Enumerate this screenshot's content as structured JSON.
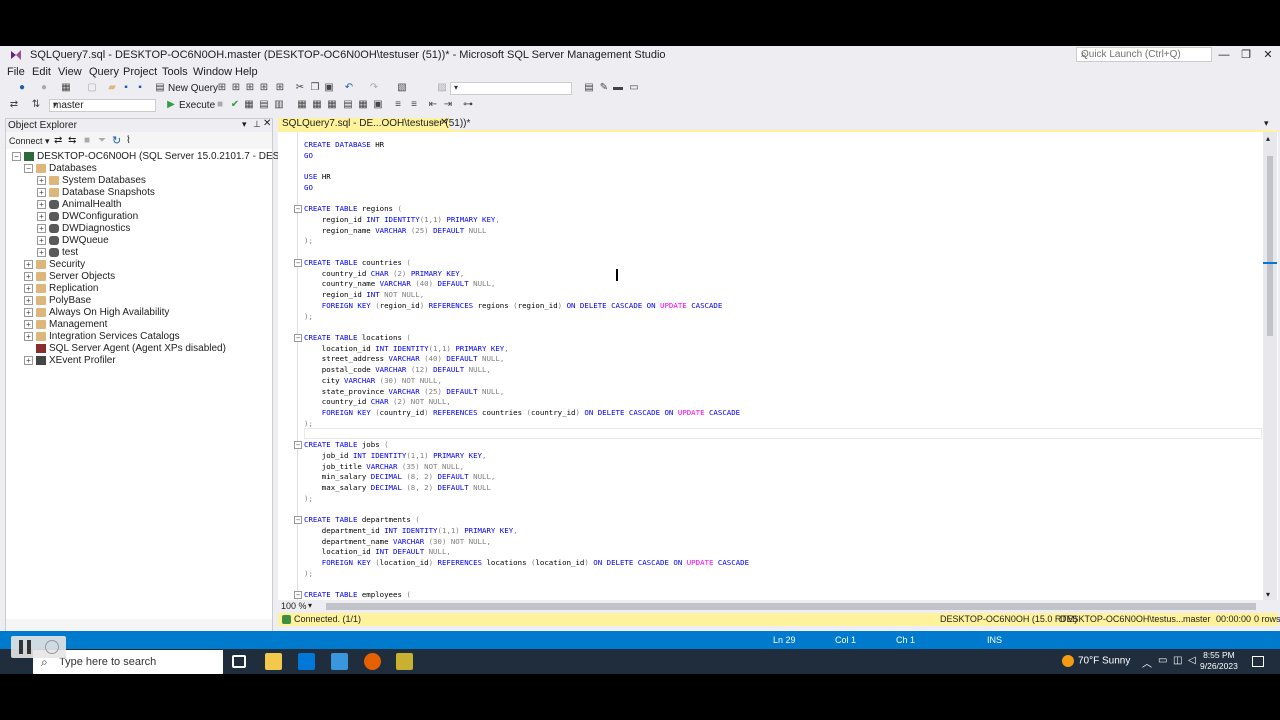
{
  "window": {
    "title": "SQLQuery7.sql - DESKTOP-OC6N0OH.master (DESKTOP-OC6N0OH\\testuser (51))* - Microsoft SQL Server Management Studio",
    "quick_launch_placeholder": "Quick Launch (Ctrl+Q)",
    "minimize": "—",
    "restore": "❐",
    "close": "✕"
  },
  "menu": [
    "File",
    "Edit",
    "View",
    "Query",
    "Project",
    "Tools",
    "Window",
    "Help"
  ],
  "toolbar1": {
    "new_query_label": "New Query"
  },
  "toolbar2": {
    "database_selected": "master",
    "execute_label": "Execute"
  },
  "object_explorer": {
    "header": "Object Explorer",
    "connect_label": "Connect ▾",
    "server_node": "DESKTOP-OC6N0OH (SQL Server 15.0.2101.7 - DESKTOP-OC6N0OH\\testuser)",
    "tree": [
      {
        "label": "Databases",
        "level": 1,
        "expander": "−",
        "icon": "folder"
      },
      {
        "label": "System Databases",
        "level": 2,
        "expander": "+",
        "icon": "folder"
      },
      {
        "label": "Database Snapshots",
        "level": 2,
        "expander": "+",
        "icon": "folder"
      },
      {
        "label": "AnimalHealth",
        "level": 2,
        "expander": "+",
        "icon": "db"
      },
      {
        "label": "DWConfiguration",
        "level": 2,
        "expander": "+",
        "icon": "db"
      },
      {
        "label": "DWDiagnostics",
        "level": 2,
        "expander": "+",
        "icon": "db"
      },
      {
        "label": "DWQueue",
        "level": 2,
        "expander": "+",
        "icon": "db"
      },
      {
        "label": "test",
        "level": 2,
        "expander": "+",
        "icon": "db"
      },
      {
        "label": "Security",
        "level": 1,
        "expander": "+",
        "icon": "folder"
      },
      {
        "label": "Server Objects",
        "level": 1,
        "expander": "+",
        "icon": "folder"
      },
      {
        "label": "Replication",
        "level": 1,
        "expander": "+",
        "icon": "folder"
      },
      {
        "label": "PolyBase",
        "level": 1,
        "expander": "+",
        "icon": "folder"
      },
      {
        "label": "Always On High Availability",
        "level": 1,
        "expander": "+",
        "icon": "folder"
      },
      {
        "label": "Management",
        "level": 1,
        "expander": "+",
        "icon": "folder"
      },
      {
        "label": "Integration Services Catalogs",
        "level": 1,
        "expander": "+",
        "icon": "folder"
      },
      {
        "label": "SQL Server Agent (Agent XPs disabled)",
        "level": 1,
        "expander": "",
        "icon": "agent"
      },
      {
        "label": "XEvent Profiler",
        "level": 1,
        "expander": "+",
        "icon": "xevent"
      }
    ]
  },
  "editor": {
    "tab_label": "SQLQuery7.sql - DE...OOH\\testuser (51))*",
    "zoom": "100 %",
    "lines": [
      {
        "y": 0,
        "fold": false,
        "spans": [
          [
            "kw",
            "CREATE DATABASE "
          ],
          [
            "",
            "HR"
          ]
        ]
      },
      {
        "y": 1,
        "fold": false,
        "spans": [
          [
            "kw",
            "GO"
          ]
        ]
      },
      {
        "y": 3,
        "fold": false,
        "spans": [
          [
            "kw",
            "USE "
          ],
          [
            "",
            "HR"
          ]
        ]
      },
      {
        "y": 4,
        "fold": false,
        "spans": [
          [
            "kw",
            "GO"
          ]
        ]
      },
      {
        "y": 6,
        "fold": true,
        "spans": [
          [
            "kw",
            "CREATE TABLE "
          ],
          [
            "",
            "regions "
          ],
          [
            "gray",
            "("
          ]
        ]
      },
      {
        "y": 7,
        "fold": false,
        "spans": [
          [
            "",
            "    region_id "
          ],
          [
            "kw",
            "INT IDENTITY"
          ],
          [
            "gray",
            "(1,1) "
          ],
          [
            "kw",
            "PRIMARY KEY"
          ],
          [
            "gray",
            ","
          ]
        ]
      },
      {
        "y": 8,
        "fold": false,
        "spans": [
          [
            "",
            "    region_name "
          ],
          [
            "kw",
            "VARCHAR "
          ],
          [
            "gray",
            "(25) "
          ],
          [
            "kw",
            "DEFAULT "
          ],
          [
            "gray",
            "NULL"
          ]
        ]
      },
      {
        "y": 9,
        "fold": false,
        "spans": [
          [
            "gray",
            ");"
          ]
        ]
      },
      {
        "y": 11,
        "fold": true,
        "spans": [
          [
            "kw",
            "CREATE TABLE "
          ],
          [
            "",
            "countries "
          ],
          [
            "gray",
            "("
          ]
        ]
      },
      {
        "y": 12,
        "fold": false,
        "spans": [
          [
            "",
            "    country_id "
          ],
          [
            "kw",
            "CHAR "
          ],
          [
            "gray",
            "(2) "
          ],
          [
            "kw",
            "PRIMARY KEY"
          ],
          [
            "gray",
            ","
          ]
        ]
      },
      {
        "y": 13,
        "fold": false,
        "spans": [
          [
            "",
            "    country_name "
          ],
          [
            "kw",
            "VARCHAR "
          ],
          [
            "gray",
            "(40) "
          ],
          [
            "kw",
            "DEFAULT "
          ],
          [
            "gray",
            "NULL,"
          ]
        ]
      },
      {
        "y": 14,
        "fold": false,
        "spans": [
          [
            "",
            "    region_id "
          ],
          [
            "kw",
            "INT "
          ],
          [
            "gray",
            "NOT NULL,"
          ]
        ]
      },
      {
        "y": 15,
        "fold": false,
        "spans": [
          [
            "kw",
            "    FOREIGN KEY "
          ],
          [
            "gray",
            "("
          ],
          [
            "",
            "region_id"
          ],
          [
            "gray",
            ") "
          ],
          [
            "kw",
            "REFERENCES "
          ],
          [
            "",
            "regions "
          ],
          [
            "gray",
            "("
          ],
          [
            "",
            "region_id"
          ],
          [
            "gray",
            ") "
          ],
          [
            "kw",
            "ON DELETE CASCADE ON "
          ],
          [
            "mag",
            "UPDATE "
          ],
          [
            "kw",
            "CASCADE"
          ]
        ]
      },
      {
        "y": 16,
        "fold": false,
        "spans": [
          [
            "gray",
            ");"
          ]
        ]
      },
      {
        "y": 18,
        "fold": true,
        "spans": [
          [
            "kw",
            "CREATE TABLE "
          ],
          [
            "",
            "locations "
          ],
          [
            "gray",
            "("
          ]
        ]
      },
      {
        "y": 19,
        "fold": false,
        "spans": [
          [
            "",
            "    location_id "
          ],
          [
            "kw",
            "INT IDENTITY"
          ],
          [
            "gray",
            "(1,1) "
          ],
          [
            "kw",
            "PRIMARY KEY"
          ],
          [
            "gray",
            ","
          ]
        ]
      },
      {
        "y": 20,
        "fold": false,
        "spans": [
          [
            "",
            "    street_address "
          ],
          [
            "kw",
            "VARCHAR "
          ],
          [
            "gray",
            "(40) "
          ],
          [
            "kw",
            "DEFAULT "
          ],
          [
            "gray",
            "NULL,"
          ]
        ]
      },
      {
        "y": 21,
        "fold": false,
        "spans": [
          [
            "",
            "    postal_code "
          ],
          [
            "kw",
            "VARCHAR "
          ],
          [
            "gray",
            "(12) "
          ],
          [
            "kw",
            "DEFAULT "
          ],
          [
            "gray",
            "NULL,"
          ]
        ]
      },
      {
        "y": 22,
        "fold": false,
        "spans": [
          [
            "",
            "    city "
          ],
          [
            "kw",
            "VARCHAR "
          ],
          [
            "gray",
            "(30) NOT NULL,"
          ]
        ]
      },
      {
        "y": 23,
        "fold": false,
        "spans": [
          [
            "",
            "    state_province "
          ],
          [
            "kw",
            "VARCHAR "
          ],
          [
            "gray",
            "(25) "
          ],
          [
            "kw",
            "DEFAULT "
          ],
          [
            "gray",
            "NULL,"
          ]
        ]
      },
      {
        "y": 24,
        "fold": false,
        "spans": [
          [
            "",
            "    country_id "
          ],
          [
            "kw",
            "CHAR "
          ],
          [
            "gray",
            "(2) NOT NULL,"
          ]
        ]
      },
      {
        "y": 25,
        "fold": false,
        "spans": [
          [
            "kw",
            "    FOREIGN KEY "
          ],
          [
            "gray",
            "("
          ],
          [
            "",
            "country_id"
          ],
          [
            "gray",
            ") "
          ],
          [
            "kw",
            "REFERENCES "
          ],
          [
            "",
            "countries "
          ],
          [
            "gray",
            "("
          ],
          [
            "",
            "country_id"
          ],
          [
            "gray",
            ") "
          ],
          [
            "kw",
            "ON DELETE CASCADE ON "
          ],
          [
            "mag",
            "UPDATE "
          ],
          [
            "kw",
            "CASCADE"
          ]
        ]
      },
      {
        "y": 26,
        "fold": false,
        "spans": [
          [
            "gray",
            ");"
          ]
        ]
      },
      {
        "y": 28,
        "fold": true,
        "spans": [
          [
            "kw",
            "CREATE TABLE "
          ],
          [
            "",
            "jobs "
          ],
          [
            "gray",
            "("
          ]
        ]
      },
      {
        "y": 29,
        "fold": false,
        "spans": [
          [
            "",
            "    job_id "
          ],
          [
            "kw",
            "INT IDENTITY"
          ],
          [
            "gray",
            "(1,1) "
          ],
          [
            "kw",
            "PRIMARY KEY"
          ],
          [
            "gray",
            ","
          ]
        ]
      },
      {
        "y": 30,
        "fold": false,
        "spans": [
          [
            "",
            "    job_title "
          ],
          [
            "kw",
            "VARCHAR "
          ],
          [
            "gray",
            "(35) NOT NULL,"
          ]
        ]
      },
      {
        "y": 31,
        "fold": false,
        "spans": [
          [
            "",
            "    min_salary "
          ],
          [
            "kw",
            "DECIMAL "
          ],
          [
            "gray",
            "(8, 2) "
          ],
          [
            "kw",
            "DEFAULT "
          ],
          [
            "gray",
            "NULL,"
          ]
        ]
      },
      {
        "y": 32,
        "fold": false,
        "spans": [
          [
            "",
            "    max_salary "
          ],
          [
            "kw",
            "DECIMAL "
          ],
          [
            "gray",
            "(8, 2) "
          ],
          [
            "kw",
            "DEFAULT "
          ],
          [
            "gray",
            "NULL"
          ]
        ]
      },
      {
        "y": 33,
        "fold": false,
        "spans": [
          [
            "gray",
            ");"
          ]
        ]
      },
      {
        "y": 35,
        "fold": true,
        "spans": [
          [
            "kw",
            "CREATE TABLE "
          ],
          [
            "",
            "departments "
          ],
          [
            "gray",
            "("
          ]
        ]
      },
      {
        "y": 36,
        "fold": false,
        "spans": [
          [
            "",
            "    department_id "
          ],
          [
            "kw",
            "INT IDENTITY"
          ],
          [
            "gray",
            "(1,1) "
          ],
          [
            "kw",
            "PRIMARY KEY"
          ],
          [
            "gray",
            ","
          ]
        ]
      },
      {
        "y": 37,
        "fold": false,
        "spans": [
          [
            "",
            "    department_name "
          ],
          [
            "kw",
            "VARCHAR "
          ],
          [
            "gray",
            "(30) NOT NULL,"
          ]
        ]
      },
      {
        "y": 38,
        "fold": false,
        "spans": [
          [
            "",
            "    location_id "
          ],
          [
            "kw",
            "INT DEFAULT "
          ],
          [
            "gray",
            "NULL,"
          ]
        ]
      },
      {
        "y": 39,
        "fold": false,
        "spans": [
          [
            "kw",
            "    FOREIGN KEY "
          ],
          [
            "gray",
            "("
          ],
          [
            "",
            "location_id"
          ],
          [
            "gray",
            ") "
          ],
          [
            "kw",
            "REFERENCES "
          ],
          [
            "",
            "locations "
          ],
          [
            "gray",
            "("
          ],
          [
            "",
            "location_id"
          ],
          [
            "gray",
            ") "
          ],
          [
            "kw",
            "ON DELETE CASCADE ON "
          ],
          [
            "mag",
            "UPDATE "
          ],
          [
            "kw",
            "CASCADE"
          ]
        ]
      },
      {
        "y": 40,
        "fold": false,
        "spans": [
          [
            "gray",
            ");"
          ]
        ]
      },
      {
        "y": 42,
        "fold": true,
        "spans": [
          [
            "kw",
            "CREATE TABLE "
          ],
          [
            "",
            "employees "
          ],
          [
            "gray",
            "("
          ]
        ]
      }
    ]
  },
  "query_status": {
    "connection": "Connected. (1/1)",
    "server": "DESKTOP-OC6N0OH (15.0 RTM)",
    "user": "DESKTOP-OC6N0OH\\testus...",
    "database": "master",
    "elapsed": "00:00:00",
    "rows": "0 rows"
  },
  "status_bar": {
    "ln": "Ln 29",
    "col": "Col 1",
    "ch": "Ch 1",
    "mode": "INS"
  },
  "taskbar": {
    "search_placeholder": "Type here to search",
    "weather": "70°F  Sunny",
    "time": "8:55 PM",
    "date": "9/26/2023"
  },
  "colors": {
    "tab_yellow": "#fff29d",
    "status_blue": "#007acc",
    "keyword_blue": "#0000ff",
    "comment_gray": "#808080",
    "magenta": "#ff00ff"
  }
}
